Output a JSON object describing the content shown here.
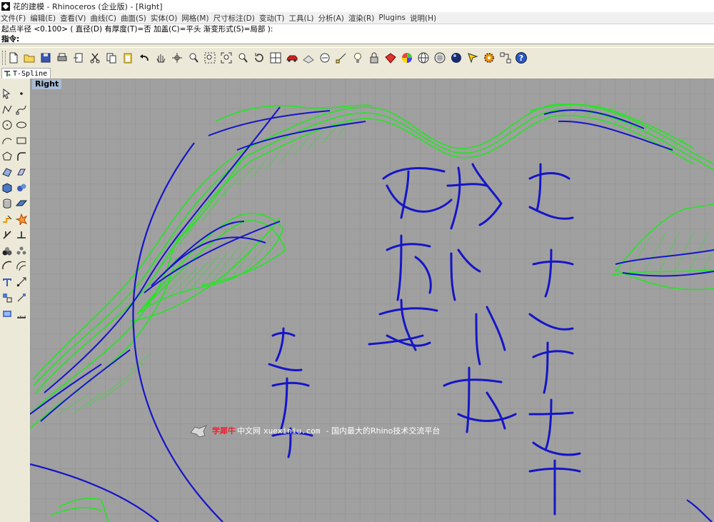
{
  "window": {
    "title": "花的建模 - Rhinoceros (企业版) - [Right]"
  },
  "menu": [
    "文件(F)",
    "编辑(E)",
    "查看(V)",
    "曲线(C)",
    "曲面(S)",
    "实体(O)",
    "网格(M)",
    "尺寸标注(D)",
    "变动(T)",
    "工具(L)",
    "分析(A)",
    "渲染(R)",
    "Plugins",
    "说明(H)"
  ],
  "command": {
    "history": "起点半径 <0.100> ( 直径(D)  有厚度(T)=否  加盖(C)=平头  渐变形式(S)=局部 ):",
    "prompt": "指令:",
    "value": ""
  },
  "toolbar_icons": [
    "new-icon",
    "open-icon",
    "save-icon",
    "print-icon",
    "import-icon",
    "cut-icon",
    "copy-icon",
    "paste-icon",
    "undo-icon",
    "pan-icon",
    "rotate-view-icon",
    "zoom-icon",
    "zoom-window-icon",
    "zoom-extents-icon",
    "zoom-selected-icon",
    "rotate-icon",
    "four-viewports-icon",
    "car-icon",
    "grid-icon",
    "point-icon",
    "osnap-icon",
    "light-icon",
    "lock-icon",
    "material-icon",
    "color-wheel-icon",
    "sphere-wire-icon",
    "sphere-render-icon",
    "sphere-shaded-icon",
    "select-icon",
    "gear-icon",
    "network-icon",
    "help-icon"
  ],
  "tabs": [
    {
      "label": "T-Spline",
      "icon": "tspline-icon"
    }
  ],
  "viewport": {
    "label": "Right"
  },
  "watermark": {
    "brand": "学犀牛",
    "site": "中文网",
    "domain": "xuexiniu.com",
    "tagline": " - 国内最大的Rhino技术交流平台"
  },
  "colors": {
    "viewport_bg": "#a0a0a0",
    "grid": "#8c8c8c",
    "curve_blue": "#1515c8",
    "mesh_green": "#22e622",
    "label_bg": "#a8bcd4"
  }
}
